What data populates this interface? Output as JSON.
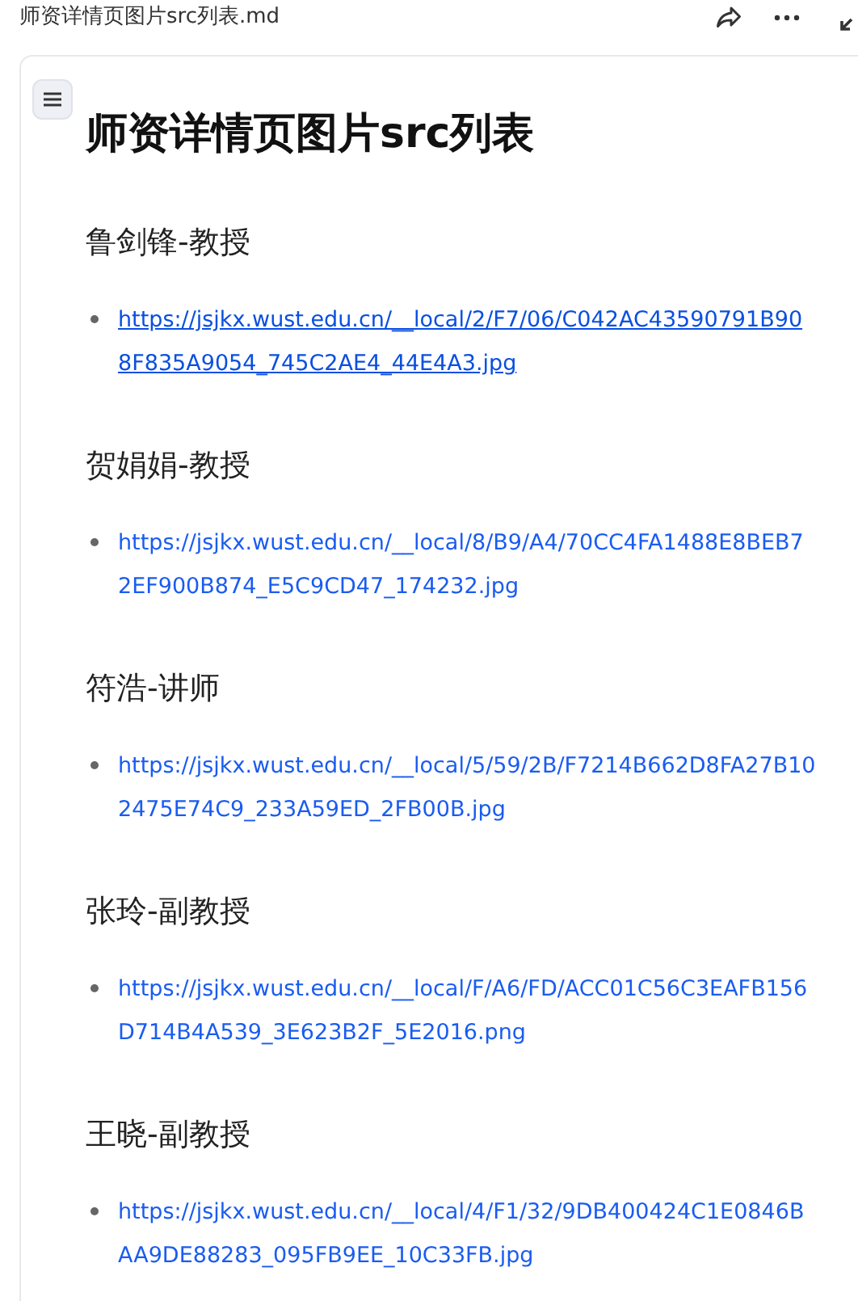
{
  "file_name": "师资详情页图片src列表.md",
  "title": "师资详情页图片src列表",
  "sections": [
    {
      "heading": "鲁剑锋-教授",
      "links": [
        {
          "text": "https://jsjkx.wust.edu.cn/__local/2/F7/06/C042AC43590791B908F835A9054_745C2AE4_44E4A3.jpg",
          "hovered": true
        }
      ]
    },
    {
      "heading": "贺娟娟-教授",
      "links": [
        {
          "text": "https://jsjkx.wust.edu.cn/__local/8/B9/A4/70CC4FA1488E8BEB72EF900B874_E5C9CD47_174232.jpg",
          "hovered": false
        }
      ]
    },
    {
      "heading": "符浩-讲师",
      "links": [
        {
          "text": "https://jsjkx.wust.edu.cn/__local/5/59/2B/F7214B662D8FA27B102475E74C9_233A59ED_2FB00B.jpg",
          "hovered": false
        }
      ]
    },
    {
      "heading": "张玲-副教授",
      "links": [
        {
          "text": "https://jsjkx.wust.edu.cn/__local/F/A6/FD/ACC01C56C3EAFB156D714B4A539_3E623B2F_5E2016.png",
          "hovered": false
        }
      ]
    },
    {
      "heading": "王晓-副教授",
      "links": [
        {
          "text": "https://jsjkx.wust.edu.cn/__local/4/F1/32/9DB400424C1E0846BAA9DE88283_095FB9EE_10C33FB.jpg",
          "hovered": false
        }
      ]
    }
  ]
}
